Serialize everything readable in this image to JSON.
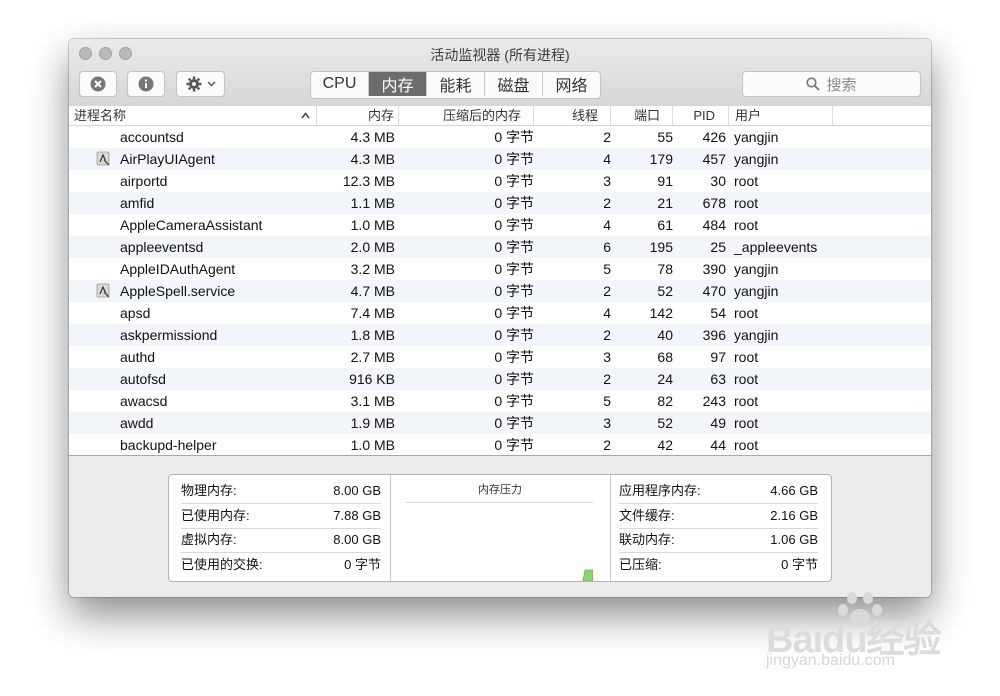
{
  "window": {
    "title": "活动监视器 (所有进程)"
  },
  "toolbar": {
    "tabs": [
      "CPU",
      "内存",
      "能耗",
      "磁盘",
      "网络"
    ],
    "active_tab": "内存",
    "search_placeholder": "搜索"
  },
  "table": {
    "headers": {
      "name": "进程名称",
      "memory": "内存",
      "compressed": "压缩后的内存",
      "threads": "线程",
      "ports": "端口",
      "pid": "PID",
      "user": "用户"
    },
    "rows": [
      {
        "name": "accountsd",
        "memory": "4.3 MB",
        "compressed": "0 字节",
        "threads": "2",
        "ports": "55",
        "pid": "426",
        "user": "yangjin"
      },
      {
        "name": "AirPlayUIAgent",
        "memory": "4.3 MB",
        "compressed": "0 字节",
        "threads": "4",
        "ports": "179",
        "pid": "457",
        "user": "yangjin"
      },
      {
        "name": "airportd",
        "memory": "12.3 MB",
        "compressed": "0 字节",
        "threads": "3",
        "ports": "91",
        "pid": "30",
        "user": "root"
      },
      {
        "name": "amfid",
        "memory": "1.1 MB",
        "compressed": "0 字节",
        "threads": "2",
        "ports": "21",
        "pid": "678",
        "user": "root"
      },
      {
        "name": "AppleCameraAssistant",
        "memory": "1.0 MB",
        "compressed": "0 字节",
        "threads": "4",
        "ports": "61",
        "pid": "484",
        "user": "root"
      },
      {
        "name": "appleeventsd",
        "memory": "2.0 MB",
        "compressed": "0 字节",
        "threads": "6",
        "ports": "195",
        "pid": "25",
        "user": "_appleevents"
      },
      {
        "name": "AppleIDAuthAgent",
        "memory": "3.2 MB",
        "compressed": "0 字节",
        "threads": "5",
        "ports": "78",
        "pid": "390",
        "user": "yangjin"
      },
      {
        "name": "AppleSpell.service",
        "memory": "4.7 MB",
        "compressed": "0 字节",
        "threads": "2",
        "ports": "52",
        "pid": "470",
        "user": "yangjin"
      },
      {
        "name": "apsd",
        "memory": "7.4 MB",
        "compressed": "0 字节",
        "threads": "4",
        "ports": "142",
        "pid": "54",
        "user": "root"
      },
      {
        "name": "askpermissiond",
        "memory": "1.8 MB",
        "compressed": "0 字节",
        "threads": "2",
        "ports": "40",
        "pid": "396",
        "user": "yangjin"
      },
      {
        "name": "authd",
        "memory": "2.7 MB",
        "compressed": "0 字节",
        "threads": "3",
        "ports": "68",
        "pid": "97",
        "user": "root"
      },
      {
        "name": "autofsd",
        "memory": "916 KB",
        "compressed": "0 字节",
        "threads": "2",
        "ports": "24",
        "pid": "63",
        "user": "root"
      },
      {
        "name": "awacsd",
        "memory": "3.1 MB",
        "compressed": "0 字节",
        "threads": "5",
        "ports": "82",
        "pid": "243",
        "user": "root"
      },
      {
        "name": "awdd",
        "memory": "1.9 MB",
        "compressed": "0 字节",
        "threads": "3",
        "ports": "52",
        "pid": "49",
        "user": "root"
      },
      {
        "name": "backupd-helper",
        "memory": "1.0 MB",
        "compressed": "0 字节",
        "threads": "2",
        "ports": "42",
        "pid": "44",
        "user": "root"
      }
    ]
  },
  "summary": {
    "left": [
      {
        "label": "物理内存:",
        "value": "8.00 GB"
      },
      {
        "label": "已使用内存:",
        "value": "7.88 GB"
      },
      {
        "label": "虚拟内存:",
        "value": "8.00 GB"
      },
      {
        "label": "已使用的交换:",
        "value": "0 字节"
      }
    ],
    "pressure_title": "内存压力",
    "right": [
      {
        "label": "应用程序内存:",
        "value": "4.66 GB"
      },
      {
        "label": "文件缓存:",
        "value": "2.16 GB"
      },
      {
        "label": "联动内存:",
        "value": "1.06 GB"
      },
      {
        "label": "已压缩:",
        "value": "0 字节"
      }
    ]
  },
  "watermark": {
    "brand": "Baidu经验",
    "url": "jingyan.baidu.com"
  },
  "colors": {
    "active_tab": "#6c6c6c",
    "pressure_green": "#86d86a",
    "row_alt": "#f2f5fa"
  }
}
